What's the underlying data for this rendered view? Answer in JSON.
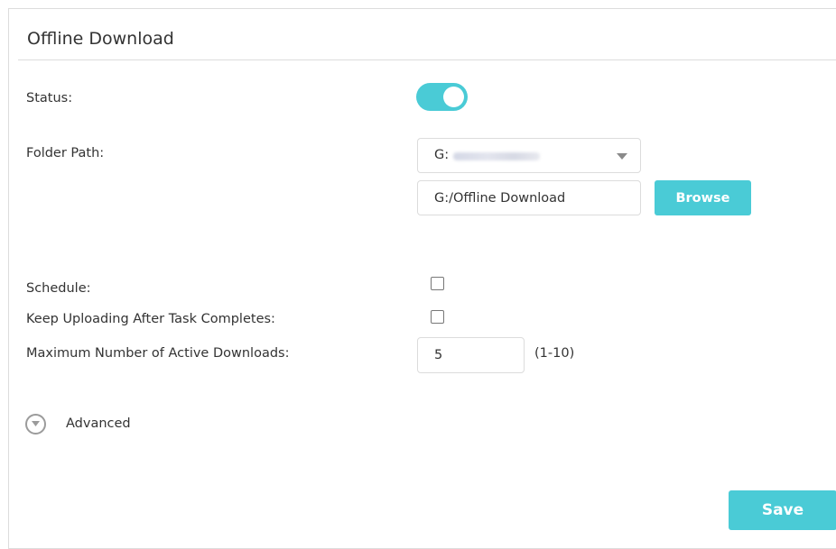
{
  "panel": {
    "title": "Offline Download"
  },
  "status": {
    "label": "Status:",
    "enabled": true,
    "accent_color": "#4acbd6"
  },
  "folder_path": {
    "label": "Folder Path:",
    "selected_drive": "G:",
    "path_value": "G:/Offline Download",
    "browse_label": "Browse"
  },
  "schedule": {
    "label": "Schedule:",
    "checked": false
  },
  "keep_uploading": {
    "label": "Keep Uploading After Task Completes:",
    "checked": false
  },
  "max_downloads": {
    "label": "Maximum Number of Active Downloads:",
    "value": "5",
    "range_hint": "(1-10)"
  },
  "advanced": {
    "label": "Advanced",
    "icon": "chevron-down-circle-icon"
  },
  "actions": {
    "save_label": "Save"
  }
}
